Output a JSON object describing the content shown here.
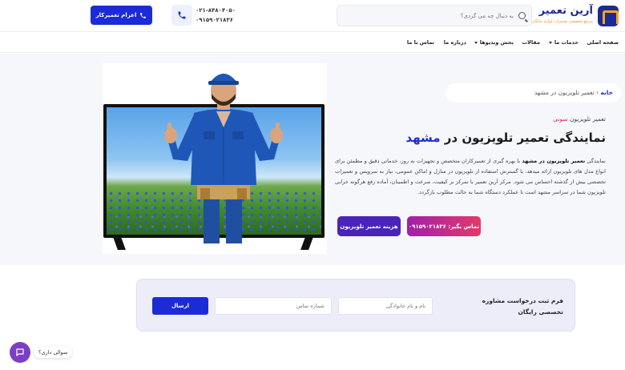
{
  "header": {
    "logo_title": "آرین تعمیر",
    "logo_subtitle": "مرجع تخصصی تعمیرات لوازم خانگی",
    "search_placeholder": "به دنبال چه می گردی؟",
    "phone_1": "۰۲۱-۸۴۸۰۴۰۵۰",
    "phone_2": "۰۹۱۵۹۰۲۱۸۳۶",
    "dispatch_label": "اعزام تعمیرکار"
  },
  "nav": {
    "items": [
      "صفحه اصلی",
      "خدمات ما",
      "مقالات",
      "بخش ویدیوها",
      "درباره ما",
      "تماس با ما"
    ]
  },
  "hero": {
    "breadcrumb_home": "خانه",
    "breadcrumb_sep": "›",
    "breadcrumb_current": "تعمیر تلویزیون در مشهد",
    "subtitle_prefix": "تعمیر تلویزیون",
    "subtitle_brand": "سونی",
    "title_prefix": "نمایندگی تعمیر تلویزیون در",
    "title_city": "مشهد",
    "desc_prefix": "نمایندگی",
    "desc_bold": "تعمیر تلویزیون در مشهد",
    "desc_rest": "با بهره گیری از تعمیرکاران متخصص و تجهیزات به روز، خدماتی دقیق و مطمئن برای انواع مدل های تلویزیون ارائه میدهد. با گسترش استفاده از تلویزیون در منازل و اماکن عمومی، نیاز به سرویس و تعمیرات تخصصی بیش از گذشته احساس می شود. مرکز آرین تعمیر با تمرکز بر کیفیت، سرعت و اطمینان، آماده رفع هرگونه خرابی تلویزیون شما در سراسر مشهد است تا عملکرد دستگاه شما به حالت مطلوب بازگردد.",
    "call_label": "تماس بگیر: ۰۹۱۵۹۰۲۱۸۳۶",
    "cost_label": "هزینه تعمیر تلویزیون"
  },
  "form": {
    "title": "فرم ثبت درخواست مشاوره تخصصی رایگان",
    "name_placeholder": "نام و نام خانوادگی",
    "phone_placeholder": "شماره تماس",
    "submit_label": "ارسال"
  },
  "chat": {
    "label": "سوالی داری؟"
  },
  "colors": {
    "primary": "#1b2bd6",
    "accent": "#d81b60",
    "brand_dark": "#1c2b8f",
    "logo_accent": "#f6a623"
  }
}
